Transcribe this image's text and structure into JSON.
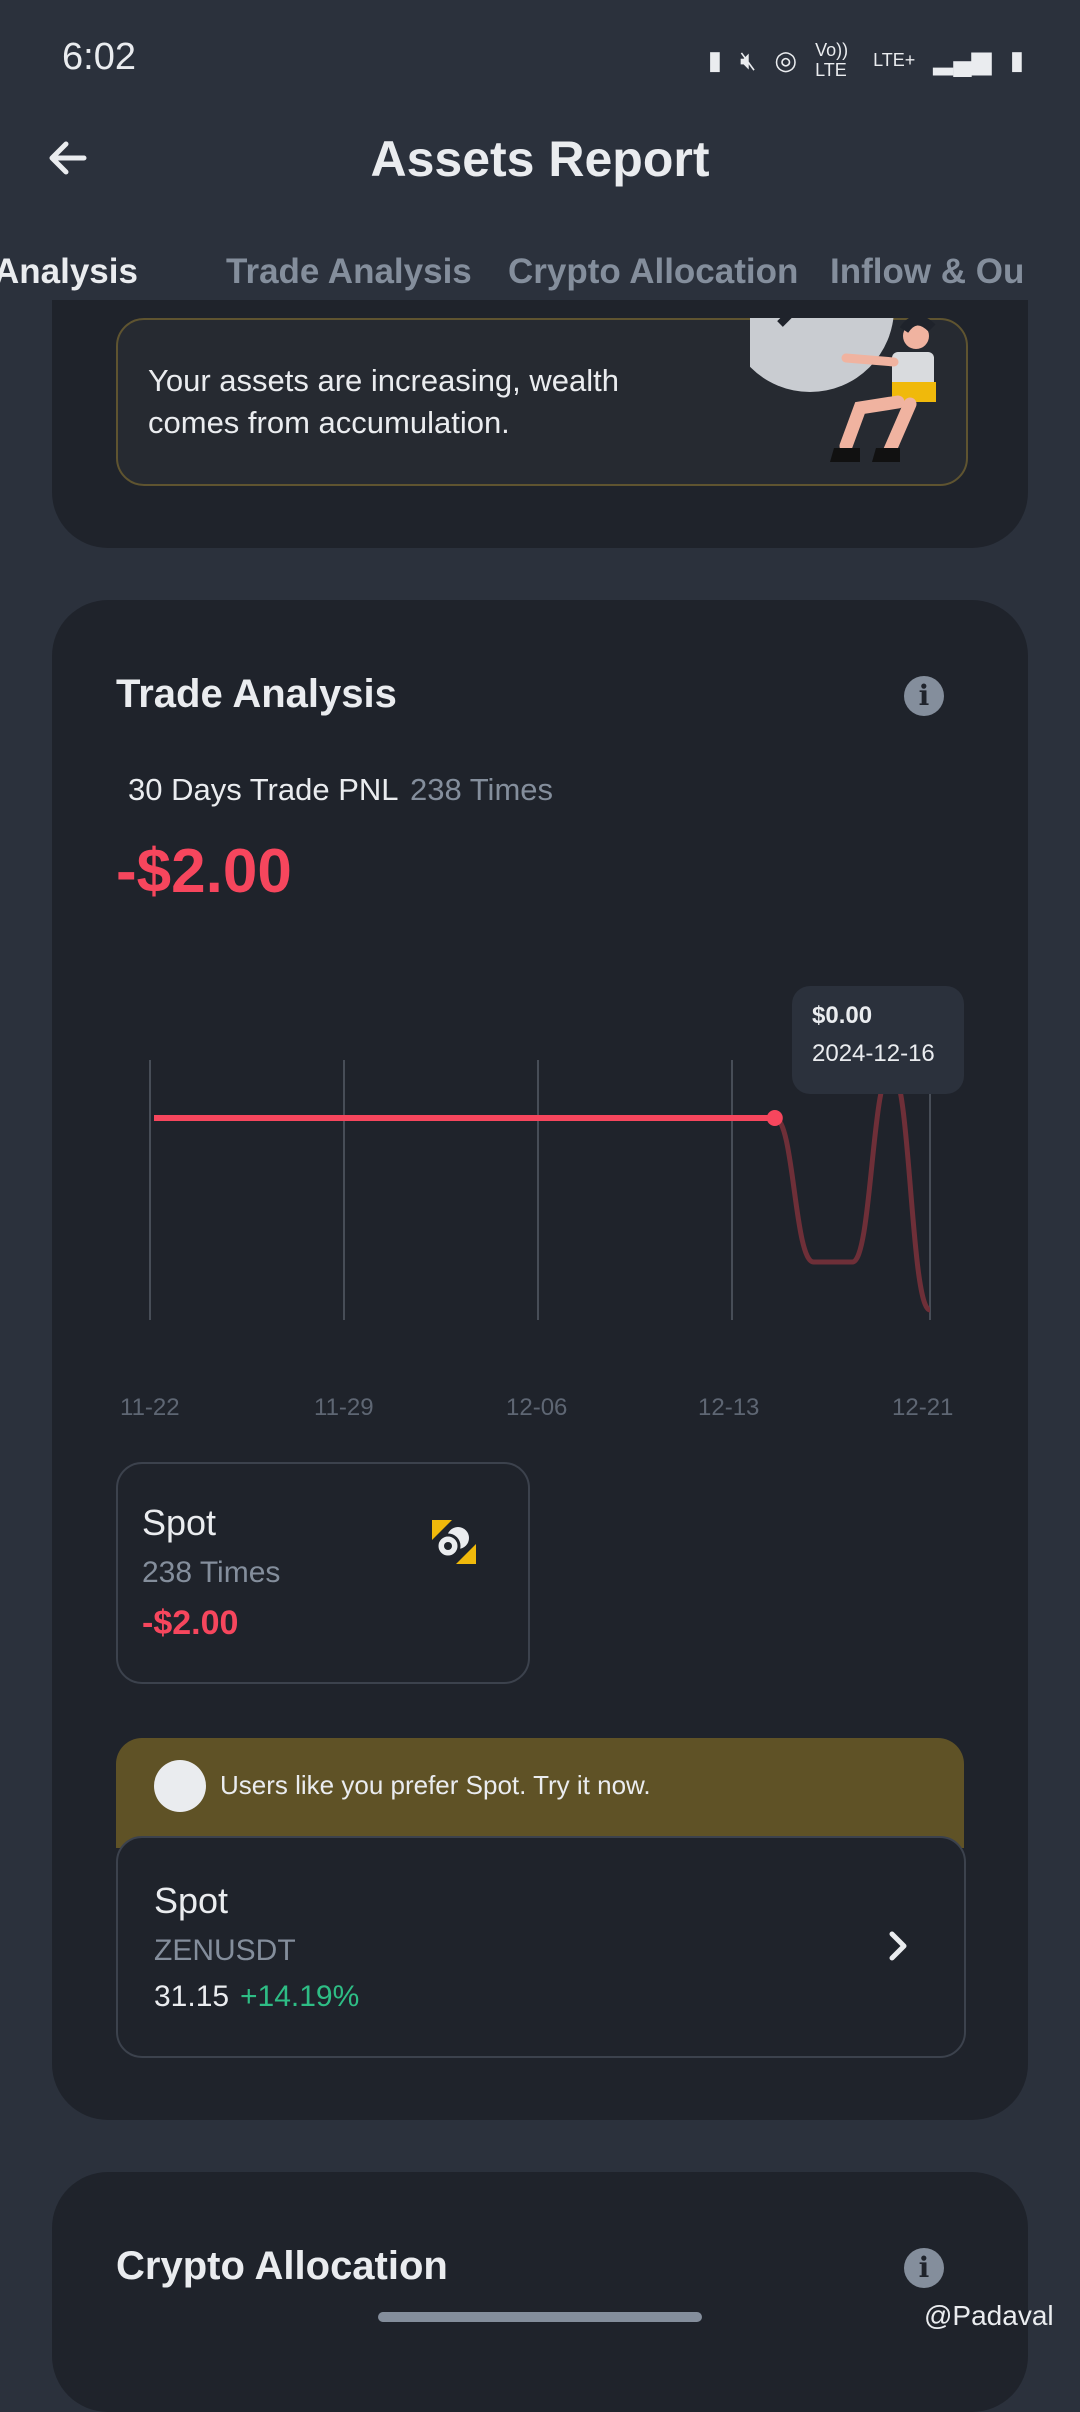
{
  "status_bar": {
    "time": "6:02",
    "icons": [
      "battery-saver-icon",
      "mute-icon",
      "hotspot-icon",
      "volte-icon",
      "lte-plus-icon",
      "signal-icon",
      "battery-icon"
    ],
    "volte_label": "Vo)) LTE",
    "lte_label": "LTE+"
  },
  "header": {
    "title": "Assets Report",
    "back_icon": "arrow-left-icon"
  },
  "tabs": [
    {
      "label": "Analysis",
      "active": true
    },
    {
      "label": "Trade Analysis",
      "active": false
    },
    {
      "label": "Crypto Allocation",
      "active": false
    },
    {
      "label": "Inflow & Ou",
      "active": false
    }
  ],
  "summary": {
    "insight": "Your assets are increasing, wealth comes from accumulation."
  },
  "trade_analysis": {
    "title": "Trade Analysis",
    "pnl_label": "30 Days Trade PNL",
    "pnl_times": "238 Times",
    "pnl_value": "-$2.00",
    "tooltip": {
      "value": "$0.00",
      "date": "2024-12-16"
    },
    "spot_card": {
      "title": "Spot",
      "times": "238 Times",
      "pnl": "-$2.00"
    },
    "promo": {
      "banner": "Users like you prefer Spot. Try it now.",
      "title": "Spot",
      "pair": "ZENUSDT",
      "price": "31.15",
      "change": "+14.19%"
    }
  },
  "crypto_allocation": {
    "title": "Crypto Allocation"
  },
  "watermark": "@Padaval",
  "colors": {
    "negative": "#f6465d",
    "positive": "#2ebd85",
    "accent": "#f0b90b",
    "card": "#1f232b",
    "background": "#2b313c"
  },
  "chart_data": {
    "type": "line",
    "x_ticks": [
      "11-22",
      "11-29",
      "12-06",
      "12-13",
      "12-21"
    ],
    "series": [
      {
        "values": [
          0,
          0,
          0,
          0,
          0,
          0,
          0,
          0,
          0,
          0,
          0,
          0,
          0,
          0,
          0,
          0,
          0,
          -0.6,
          -0.6,
          0.2,
          -0.8
        ]
      }
    ],
    "highlight": {
      "x": "2024-12-16",
      "y": 0
    },
    "grid": true
  }
}
